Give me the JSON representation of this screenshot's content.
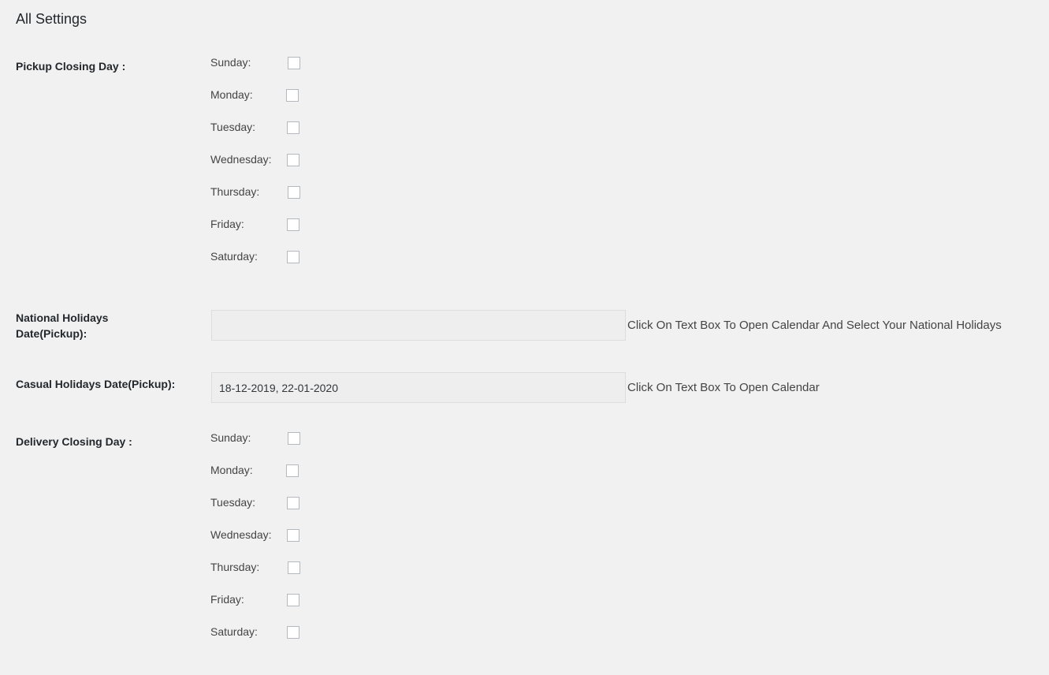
{
  "page": {
    "title": "All Settings"
  },
  "pickup_closing": {
    "label": "Pickup Closing Day :",
    "days": [
      {
        "label": "Sunday:",
        "checked": false
      },
      {
        "label": "Monday:",
        "checked": false
      },
      {
        "label": "Tuesday:",
        "checked": false
      },
      {
        "label": "Wednesday:",
        "checked": false
      },
      {
        "label": "Thursday:",
        "checked": false
      },
      {
        "label": "Friday:",
        "checked": false
      },
      {
        "label": "Saturday:",
        "checked": false
      }
    ]
  },
  "national_holidays": {
    "label_line1": "National Holidays",
    "label_line2": "Date(Pickup):",
    "value": "",
    "helper": "Click On Text Box To Open Calendar And Select Your National Holidays"
  },
  "casual_holidays": {
    "label": "Casual Holidays Date(Pickup):",
    "value": "18-12-2019, 22-01-2020",
    "helper": "Click On Text Box To Open Calendar"
  },
  "delivery_closing": {
    "label": "Delivery Closing Day :",
    "days": [
      {
        "label": "Sunday:",
        "checked": false
      },
      {
        "label": "Monday:",
        "checked": false
      },
      {
        "label": "Tuesday:",
        "checked": false
      },
      {
        "label": "Wednesday:",
        "checked": false
      },
      {
        "label": "Thursday:",
        "checked": false
      },
      {
        "label": "Friday:",
        "checked": false
      },
      {
        "label": "Saturday:",
        "checked": false
      }
    ]
  },
  "colors": {
    "background": "#f1f1f1",
    "input_background": "#eeeeee",
    "input_border": "#dddddd",
    "checkbox_border": "#b4b9be"
  }
}
